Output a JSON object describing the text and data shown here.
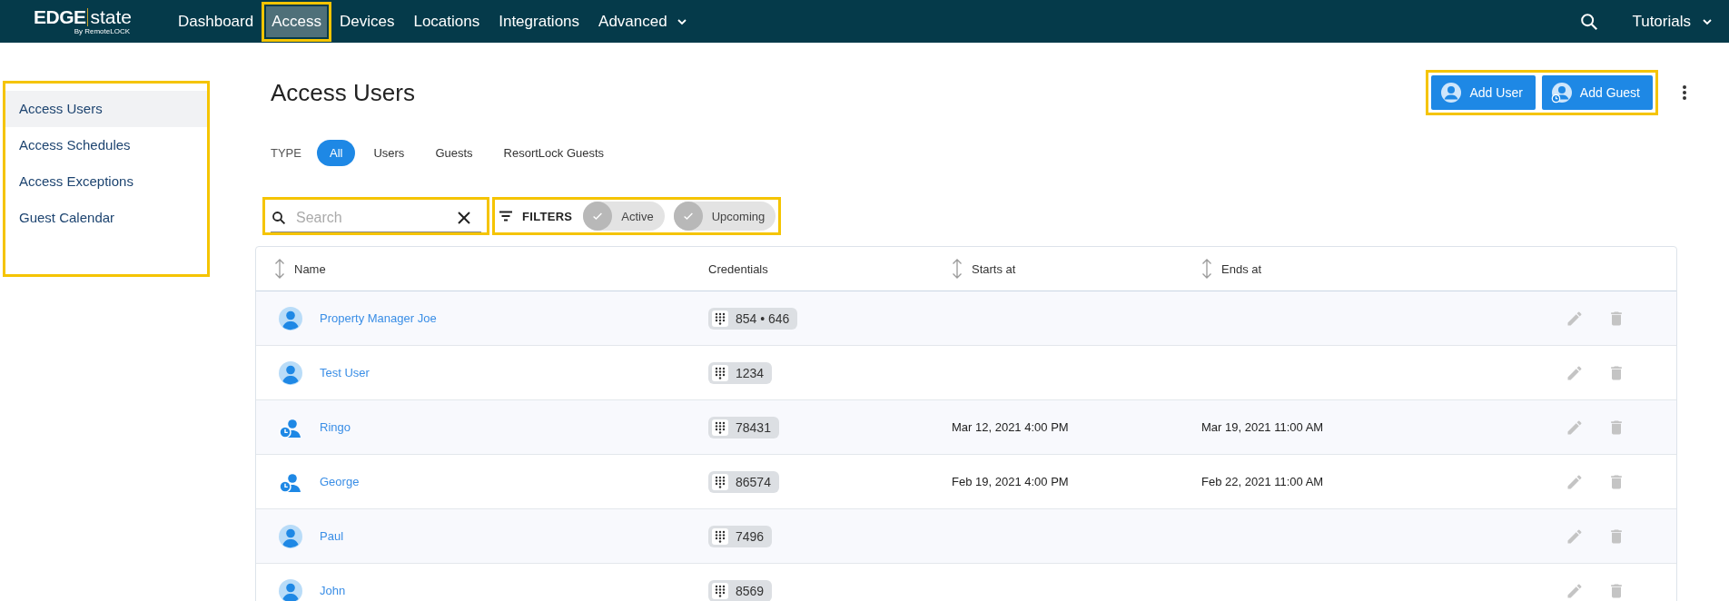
{
  "logo": {
    "brand": "EDGE",
    "product": "state",
    "byline": "By RemoteLOCK"
  },
  "nav": [
    {
      "label": "Dashboard",
      "selected": false,
      "highlighted": false,
      "dropdown": false
    },
    {
      "label": "Access",
      "selected": true,
      "highlighted": true,
      "dropdown": false
    },
    {
      "label": "Devices",
      "selected": false,
      "highlighted": false,
      "dropdown": false
    },
    {
      "label": "Locations",
      "selected": false,
      "highlighted": false,
      "dropdown": false
    },
    {
      "label": "Integrations",
      "selected": false,
      "highlighted": false,
      "dropdown": false
    },
    {
      "label": "Advanced",
      "selected": false,
      "highlighted": false,
      "dropdown": true
    }
  ],
  "nav_right": {
    "tutorials": "Tutorials"
  },
  "sidebar": {
    "highlighted": true,
    "items": [
      {
        "label": "Access Users",
        "selected": true
      },
      {
        "label": "Access Schedules",
        "selected": false
      },
      {
        "label": "Access Exceptions",
        "selected": false
      },
      {
        "label": "Guest Calendar",
        "selected": false
      }
    ]
  },
  "page_title": "Access Users",
  "actions": {
    "highlighted": true,
    "buttons": [
      {
        "label": "Add User",
        "kind": "user"
      },
      {
        "label": "Add Guest",
        "kind": "guest"
      }
    ]
  },
  "type_filter": {
    "label": "TYPE",
    "options": [
      {
        "label": "All",
        "selected": true
      },
      {
        "label": "Users",
        "selected": false
      },
      {
        "label": "Guests",
        "selected": false
      },
      {
        "label": "ResortLock Guests",
        "selected": false
      }
    ]
  },
  "search": {
    "placeholder": "Search",
    "highlighted": true
  },
  "filters": {
    "label": "FILTERS",
    "highlighted": true,
    "chips": [
      {
        "label": "Active",
        "checked": false
      },
      {
        "label": "Upcoming",
        "checked": false
      }
    ]
  },
  "table": {
    "columns": [
      {
        "label": "Name",
        "sortable": true
      },
      {
        "label": "Credentials",
        "sortable": false
      },
      {
        "label": "Starts at",
        "sortable": true
      },
      {
        "label": "Ends at",
        "sortable": true
      }
    ],
    "rows": [
      {
        "kind": "user",
        "name": "Property Manager Joe",
        "credential": "854 • 646"
      },
      {
        "kind": "user",
        "name": "Test User",
        "credential": "1234"
      },
      {
        "kind": "guest",
        "name": "Ringo",
        "credential": "78431",
        "starts": "Mar 12, 2021 4:00 PM",
        "ends": "Mar 19, 2021 11:00 AM"
      },
      {
        "kind": "guest",
        "name": "George",
        "credential": "86574",
        "starts": "Feb 19, 2021 4:00 PM",
        "ends": "Feb 22, 2021 11:00 AM"
      },
      {
        "kind": "user",
        "name": "Paul",
        "credential": "7496"
      },
      {
        "kind": "user",
        "name": "John",
        "credential": "8569"
      }
    ]
  }
}
